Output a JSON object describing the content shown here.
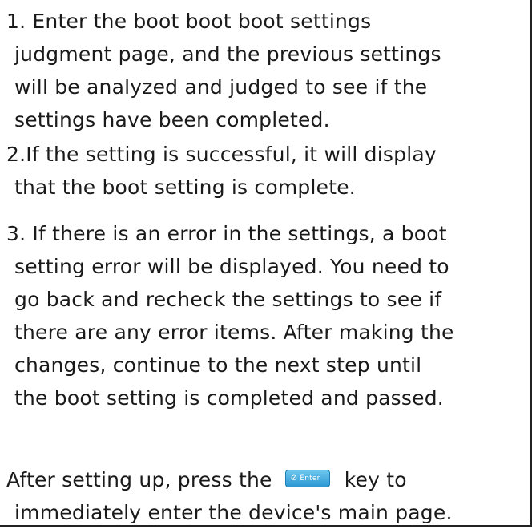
{
  "paragraphs": {
    "p1": [
      "1. Enter the boot boot boot settings",
      "judgment page, and the previous settings",
      "will be analyzed and judged to see if the",
      "settings have been completed."
    ],
    "p2": [
      "2.If the setting is successful, it will display",
      "that the boot setting is complete."
    ],
    "p3": [
      "3. If there is an error in the settings, a boot",
      "setting error will be displayed. You need to",
      "go back and recheck the settings to see if",
      "there are any error items. After making the",
      "changes, continue to the next step until",
      "the boot setting is completed and passed."
    ],
    "p4": {
      "before_key": "After setting up, press the",
      "after_key": "key to",
      "line2": "immediately enter the device's main page."
    }
  },
  "enter_key": {
    "label": "Enter",
    "icon": "check-circle-icon",
    "color": "#2b97d2"
  }
}
